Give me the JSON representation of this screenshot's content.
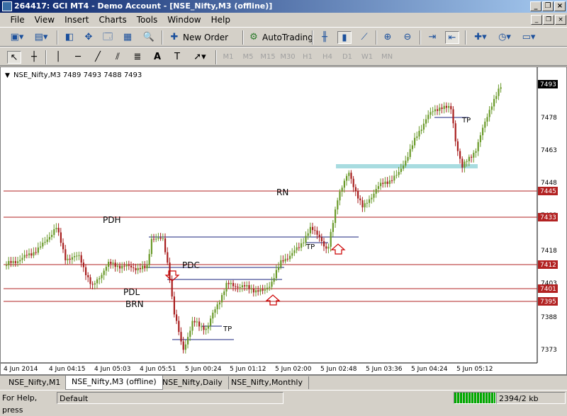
{
  "window": {
    "title": "264417: GCI MT4 - Demo Account - [NSE_Nifty,M3 (offline)]"
  },
  "menu": [
    "File",
    "View",
    "Insert",
    "Charts",
    "Tools",
    "Window",
    "Help"
  ],
  "toolbar": {
    "new_order": "New Order",
    "autotrading": "AutoTrading"
  },
  "timeframes": [
    "M1",
    "M5",
    "M15",
    "M30",
    "H1",
    "H4",
    "D1",
    "W1",
    "MN"
  ],
  "chart": {
    "header": "NSE_Nifty,M3  7489 7493 7488 7493",
    "current_price": "7493",
    "y_ticks": [
      "7478",
      "7463",
      "7448",
      "7433",
      "7418",
      "7403",
      "7388",
      "7373"
    ],
    "x_ticks": [
      "4 Jun 2014",
      "4 Jun 04:15",
      "4 Jun 05:03",
      "4 Jun 05:51",
      "5 Jun 00:24",
      "5 Jun 01:12",
      "5 Jun 02:00",
      "5 Jun 02:48",
      "5 Jun 03:36",
      "5 Jun 04:24",
      "5 Jun 05:12"
    ],
    "level_tags": [
      "7445",
      "7433",
      "7412",
      "7401",
      "7395"
    ],
    "annotations": [
      "RN",
      "PDH",
      "PDC",
      "PDL",
      "BRN",
      "TP",
      "TP",
      "TP"
    ],
    "colors": {
      "up": "#6a9a2a",
      "down": "#a81e1e",
      "level": "#b22222",
      "zone": "#a8dce0",
      "hline": "#1a237e"
    }
  },
  "tabs": [
    "NSE_Nifty,M1",
    "NSE_Nifty,M3 (offline)",
    "NSE_Nifty,Daily",
    "NSE_Nifty,Monthly"
  ],
  "status": {
    "help": "For Help, press",
    "profile": "Default",
    "traffic": "2394/2 kb"
  },
  "icons": [
    "new-chart-icon",
    "profiles-icon",
    "market-watch-icon",
    "data-window-icon",
    "navigator-icon",
    "terminal-icon",
    "tester-icon",
    "new-order-icon",
    "autotrading-icon",
    "bar-chart-icon",
    "candle-chart-icon",
    "line-chart-icon",
    "zoom-in-icon",
    "zoom-out-icon",
    "autoscroll-icon",
    "chart-shift-icon",
    "indicators-icon",
    "periods-icon",
    "templates-icon",
    "cursor-icon",
    "crosshair-icon",
    "vertical-line-icon",
    "horizontal-line-icon",
    "trendline-icon",
    "equidistant-channel-icon",
    "fibonacci-icon",
    "text-icon",
    "text-label-icon",
    "arrows-icon"
  ]
}
